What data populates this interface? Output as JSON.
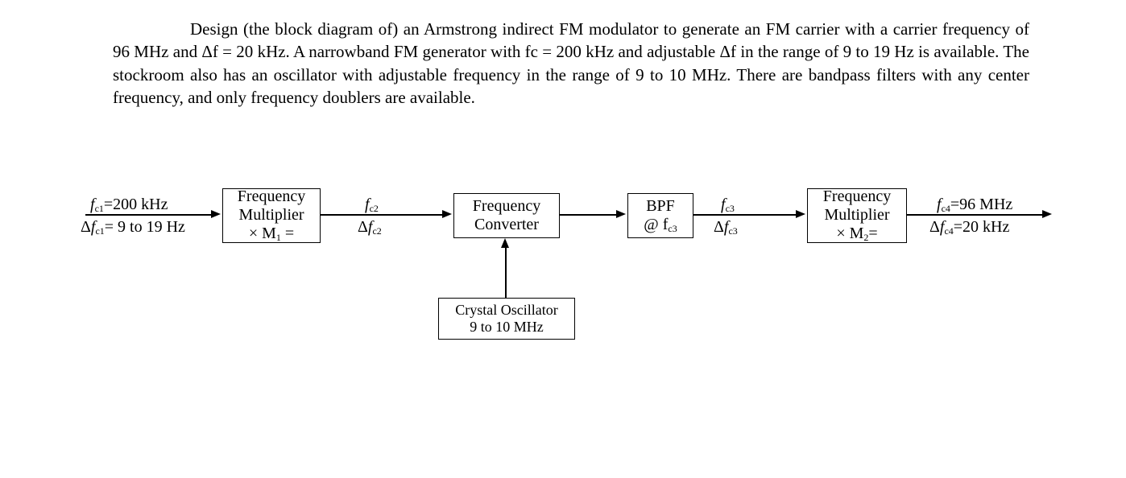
{
  "description": "Design (the block diagram of) an Armstrong indirect FM modulator to generate an FM carrier with a carrier frequency of 96 MHz and Δf = 20 kHz. A narrowband FM generator with fc = 200 kHz and adjustable Δf in the range of 9 to 19 Hz is available. The stockroom also has an oscillator with adjustable frequency in the range of 9 to 10 MHz. There are bandpass filters with any center frequency, and only frequency doublers are available.",
  "sig1": {
    "fc": "fc1=200 kHz",
    "df": "Δfc1= 9 to 19 Hz"
  },
  "mult1": {
    "l1": "Frequency",
    "l2": "Multiplier",
    "l3": "× M1 ="
  },
  "sig2": {
    "fc": "fc2",
    "df": "Δfc2"
  },
  "conv": {
    "l1": "Frequency",
    "l2": "Converter"
  },
  "bpf": {
    "l1": "BPF",
    "l2": "@ fc3"
  },
  "sig3": {
    "fc": "fc3",
    "df": "Δfc3"
  },
  "mult2": {
    "l1": "Frequency",
    "l2": "Multiplier",
    "l3": "× M2="
  },
  "sig4": {
    "fc": "fc4=96 MHz",
    "df": "Δfc4=20 kHz"
  },
  "osc": {
    "l1": "Crystal Oscillator",
    "l2": "9 to 10 MHz"
  }
}
